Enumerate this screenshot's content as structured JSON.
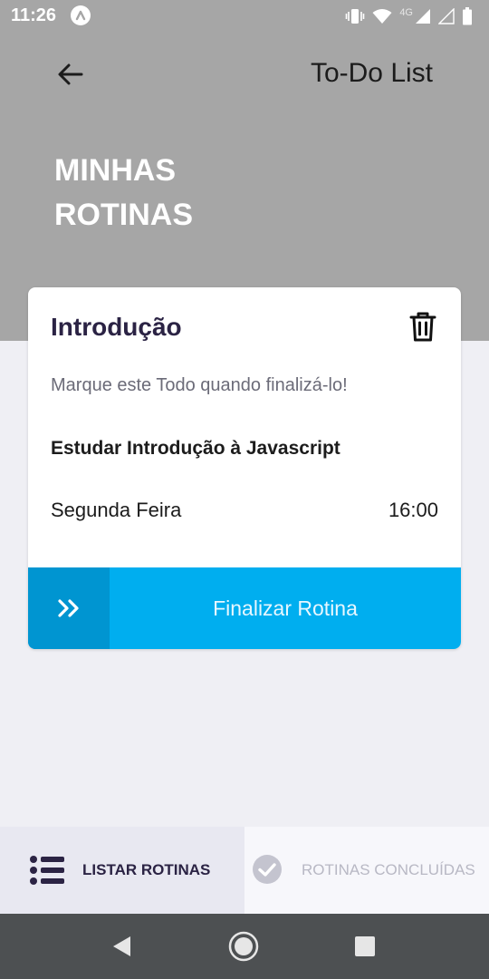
{
  "status_bar": {
    "time": "11:26",
    "network": "4G"
  },
  "header": {
    "app_title": "To-Do List",
    "page_title": "MINHAS ROTINAS"
  },
  "card": {
    "title": "Introdução",
    "hint": "Marque este Todo quando finalizá-lo!",
    "task_name": "Estudar Introdução à Javascript",
    "day": "Segunda Feira",
    "time": "16:00",
    "finish_label": "Finalizar Rotina"
  },
  "tabs": [
    {
      "label": "LISTAR ROTINAS",
      "icon": "list-icon",
      "active": true
    },
    {
      "label": "ROTINAS CONCLUÍDAS",
      "icon": "check-circle-icon",
      "active": false
    }
  ],
  "colors": {
    "header_bg": "#a6a6a6",
    "accent": "#00aeef",
    "accent_dark": "#0095d1",
    "title_dark": "#2b2344",
    "nav_bar": "#4d5052"
  }
}
